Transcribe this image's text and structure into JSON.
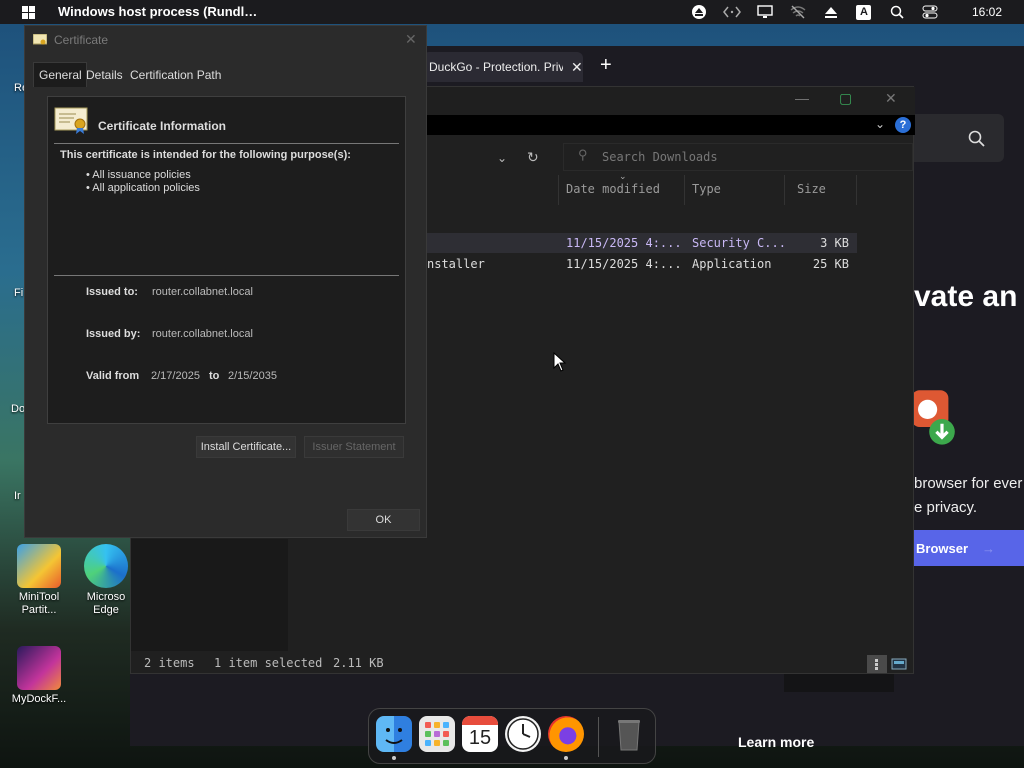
{
  "topbar": {
    "app_title": "Windows host process (Rundl…",
    "clock": "16:02",
    "tray_icons": [
      "upload-icon",
      "code-icon",
      "monitor-icon",
      "no-wifi-icon",
      "eject-icon",
      "keyboard-a-icon",
      "search-icon",
      "toggle-icon"
    ],
    "tray_keyboard_letter": "A"
  },
  "desktop": {
    "partial_labels": [
      "Re",
      "Fi",
      "Do",
      "Ir"
    ],
    "icons": [
      {
        "label": "MiniTool Partit...",
        "icon": "minitool-icon"
      },
      {
        "label": "Microso Edge",
        "icon": "edge-icon"
      },
      {
        "label": "MyDockF...",
        "icon": "mydock-icon"
      }
    ]
  },
  "browser": {
    "tab_title": "DuckGo - Protection. Priva",
    "tab_close": "✕",
    "new_tab": "+",
    "headline": "vate an",
    "tagline_line1": "browser for ever",
    "tagline_line2": "e privacy.",
    "browser_button": "Browser",
    "learn_more": "Learn more"
  },
  "explorer": {
    "search_placeholder": "Search Downloads",
    "columns": [
      "Date modified",
      "Type",
      "Size"
    ],
    "rows": [
      {
        "name": "",
        "date": "11/15/2025 4:...",
        "type": "Security C...",
        "size": "3 KB",
        "selected": true
      },
      {
        "name": "nstaller",
        "date": "11/15/2025 4:...",
        "type": "Application",
        "size": "25 KB",
        "selected": false
      }
    ],
    "status": {
      "items": "2 items",
      "selected": "1 item selected",
      "size": "2.11 KB"
    }
  },
  "certificate": {
    "title": "Certificate",
    "tabs": [
      "General",
      "Details",
      "Certification Path"
    ],
    "heading": "Certificate Information",
    "purpose_text": "This certificate is intended for the following purpose(s):",
    "policies": [
      "• All issuance policies",
      "• All application policies"
    ],
    "issued_to_label": "Issued to:",
    "issued_to": "router.collabnet.local",
    "issued_by_label": "Issued by:",
    "issued_by": "router.collabnet.local",
    "valid_from_label": "Valid from",
    "valid_from": "2/17/2025",
    "valid_to_label": "to",
    "valid_to": "2/15/2035",
    "install_button": "Install Certificate...",
    "issuer_statement_button": "Issuer Statement",
    "ok_button": "OK"
  },
  "dock": {
    "items": [
      "finder-icon",
      "launchpad-icon",
      "calendar-icon",
      "clock-icon",
      "firefox-icon",
      "trash-icon"
    ],
    "calendar_day": "15"
  }
}
